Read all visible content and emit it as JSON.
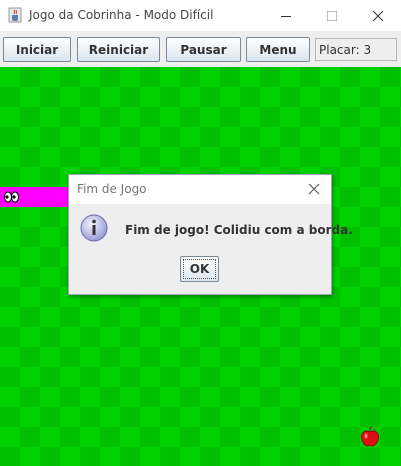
{
  "window": {
    "title": "Jogo da Cobrinha - Modo Difícil",
    "icons": {
      "app": "java-cup-icon",
      "minimize": "minimize-icon",
      "maximize": "maximize-icon",
      "close": "close-icon"
    }
  },
  "toolbar": {
    "buttons": [
      {
        "label": "Iniciar"
      },
      {
        "label": "Reiniciar"
      },
      {
        "label": "Pausar"
      },
      {
        "label": "Menu"
      }
    ],
    "score_text": "Placar: 3"
  },
  "board": {
    "colors": {
      "light": "#00d200",
      "dark": "#00c000",
      "snake": "#ff00ff",
      "apple": "#e01010"
    },
    "icons": {
      "snake_head": "snake-head-eyes-icon",
      "food": "apple-icon"
    }
  },
  "dialog": {
    "title": "Fim de Jogo",
    "message": "Fim de jogo! Colidiu com a borda.",
    "ok_label": "OK",
    "icons": {
      "info": "info-icon",
      "close": "close-icon"
    }
  }
}
